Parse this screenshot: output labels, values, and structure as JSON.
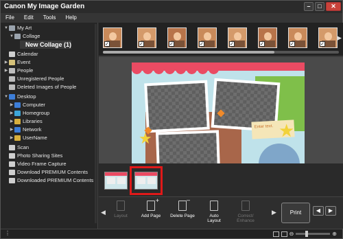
{
  "window": {
    "title": "Canon My Image Garden",
    "controls": {
      "minimize": "–",
      "maximize": "□",
      "close": "✕"
    }
  },
  "menu": [
    "File",
    "Edit",
    "Tools",
    "Help"
  ],
  "sidebar": {
    "items": [
      {
        "label": "My Art",
        "arrow": "▼",
        "icon": "folder-icon",
        "color": "#9aa3ad"
      },
      {
        "label": "Collage",
        "arrow": "▼",
        "icon": "collage-folder-icon",
        "color": "#9aa3ad"
      },
      {
        "label": "New Collage (1)",
        "arrow": "",
        "icon": "",
        "color": ""
      },
      {
        "label": "Calendar",
        "arrow": "",
        "icon": "calendar-icon",
        "color": "#cfcfcf"
      },
      {
        "label": "Event",
        "arrow": "▶",
        "icon": "event-icon",
        "color": "#d6c27a"
      },
      {
        "label": "People",
        "arrow": "▶",
        "icon": "people-icon",
        "color": "#bdbdbd"
      },
      {
        "label": "Unregistered People",
        "arrow": "",
        "icon": "unregistered-people-icon",
        "color": "#bdbdbd"
      },
      {
        "label": "Deleted Images of People",
        "arrow": "",
        "icon": "deleted-people-icon",
        "color": "#bdbdbd"
      },
      {
        "label": "Desktop",
        "arrow": "▼",
        "icon": "desktop-icon",
        "color": "#3d7ed8"
      },
      {
        "label": "Computer",
        "arrow": "▶",
        "icon": "computer-icon",
        "color": "#3d7ed8"
      },
      {
        "label": "Homegroup",
        "arrow": "▶",
        "icon": "homegroup-icon",
        "color": "#3da6d8"
      },
      {
        "label": "Libraries",
        "arrow": "▶",
        "icon": "libraries-icon",
        "color": "#d8b03d"
      },
      {
        "label": "Network",
        "arrow": "▶",
        "icon": "network-icon",
        "color": "#3d7ed8"
      },
      {
        "label": "UserName",
        "arrow": "▶",
        "icon": "user-folder-icon",
        "color": "#d8b03d"
      },
      {
        "label": "Scan",
        "arrow": "",
        "icon": "scan-icon",
        "color": "#cfcfcf"
      },
      {
        "label": "Photo Sharing Sites",
        "arrow": "",
        "icon": "photo-sharing-icon",
        "color": "#cfcfcf"
      },
      {
        "label": "Video Frame Capture",
        "arrow": "",
        "icon": "video-capture-icon",
        "color": "#cfcfcf"
      },
      {
        "label": "Download PREMIUM Contents",
        "arrow": "",
        "icon": "download-premium-icon",
        "color": "#cfcfcf"
      },
      {
        "label": "Downloaded PREMIUM Contents",
        "arrow": "",
        "icon": "downloaded-premium-icon",
        "color": "#cfcfcf"
      }
    ]
  },
  "collage": {
    "text_placeholder": "Enter text."
  },
  "toolbar": {
    "left_arrow": "◀",
    "right_arrow": "▶",
    "layout": "Layout",
    "add_page": "Add Page",
    "delete_page": "Delete Page",
    "auto_layout_1": "Auto",
    "auto_layout_2": "Layout",
    "correct_1": "Correct/",
    "correct_2": "Enhance",
    "print": "Print",
    "prev": "◀",
    "next": "▶"
  },
  "status": {
    "left": "⋮"
  },
  "colors": {
    "highlight": "#e01919",
    "awning": "#ea4b63"
  }
}
